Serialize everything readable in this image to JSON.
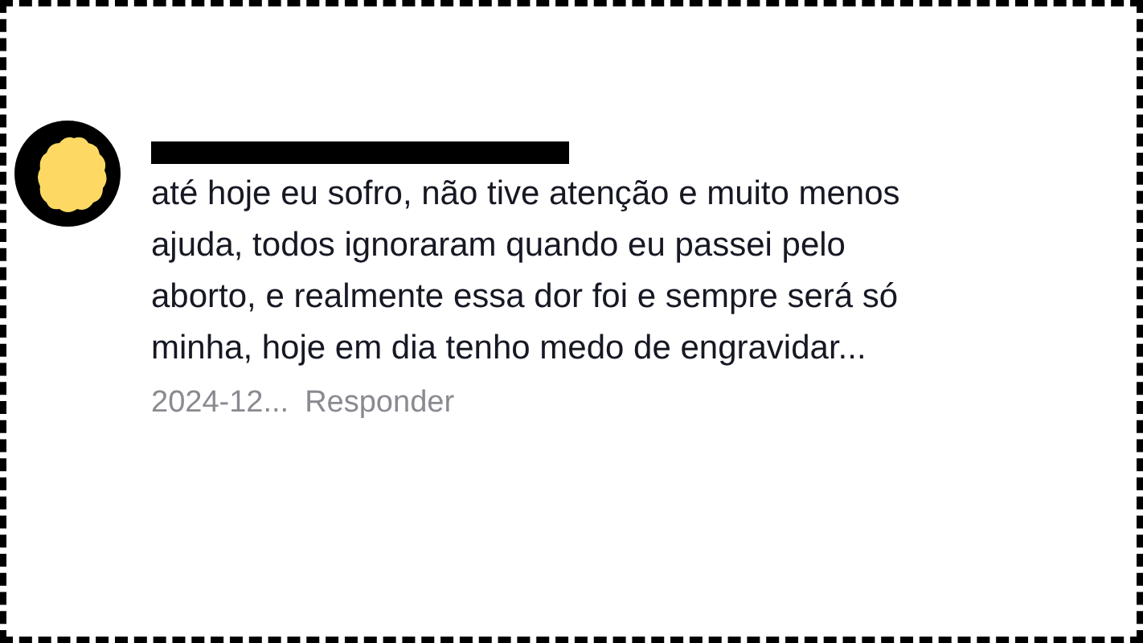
{
  "comment": {
    "author_redacted": true,
    "lines": [
      "até hoje eu sofro, não tive atenção e muito menos",
      "ajuda, todos ignoraram quando eu passei pelo",
      "aborto, e realmente essa dor foi e sempre será só",
      "minha, hoje em dia tenho medo de engravidar..."
    ],
    "date": "2024-12...",
    "reply": "Responder"
  }
}
